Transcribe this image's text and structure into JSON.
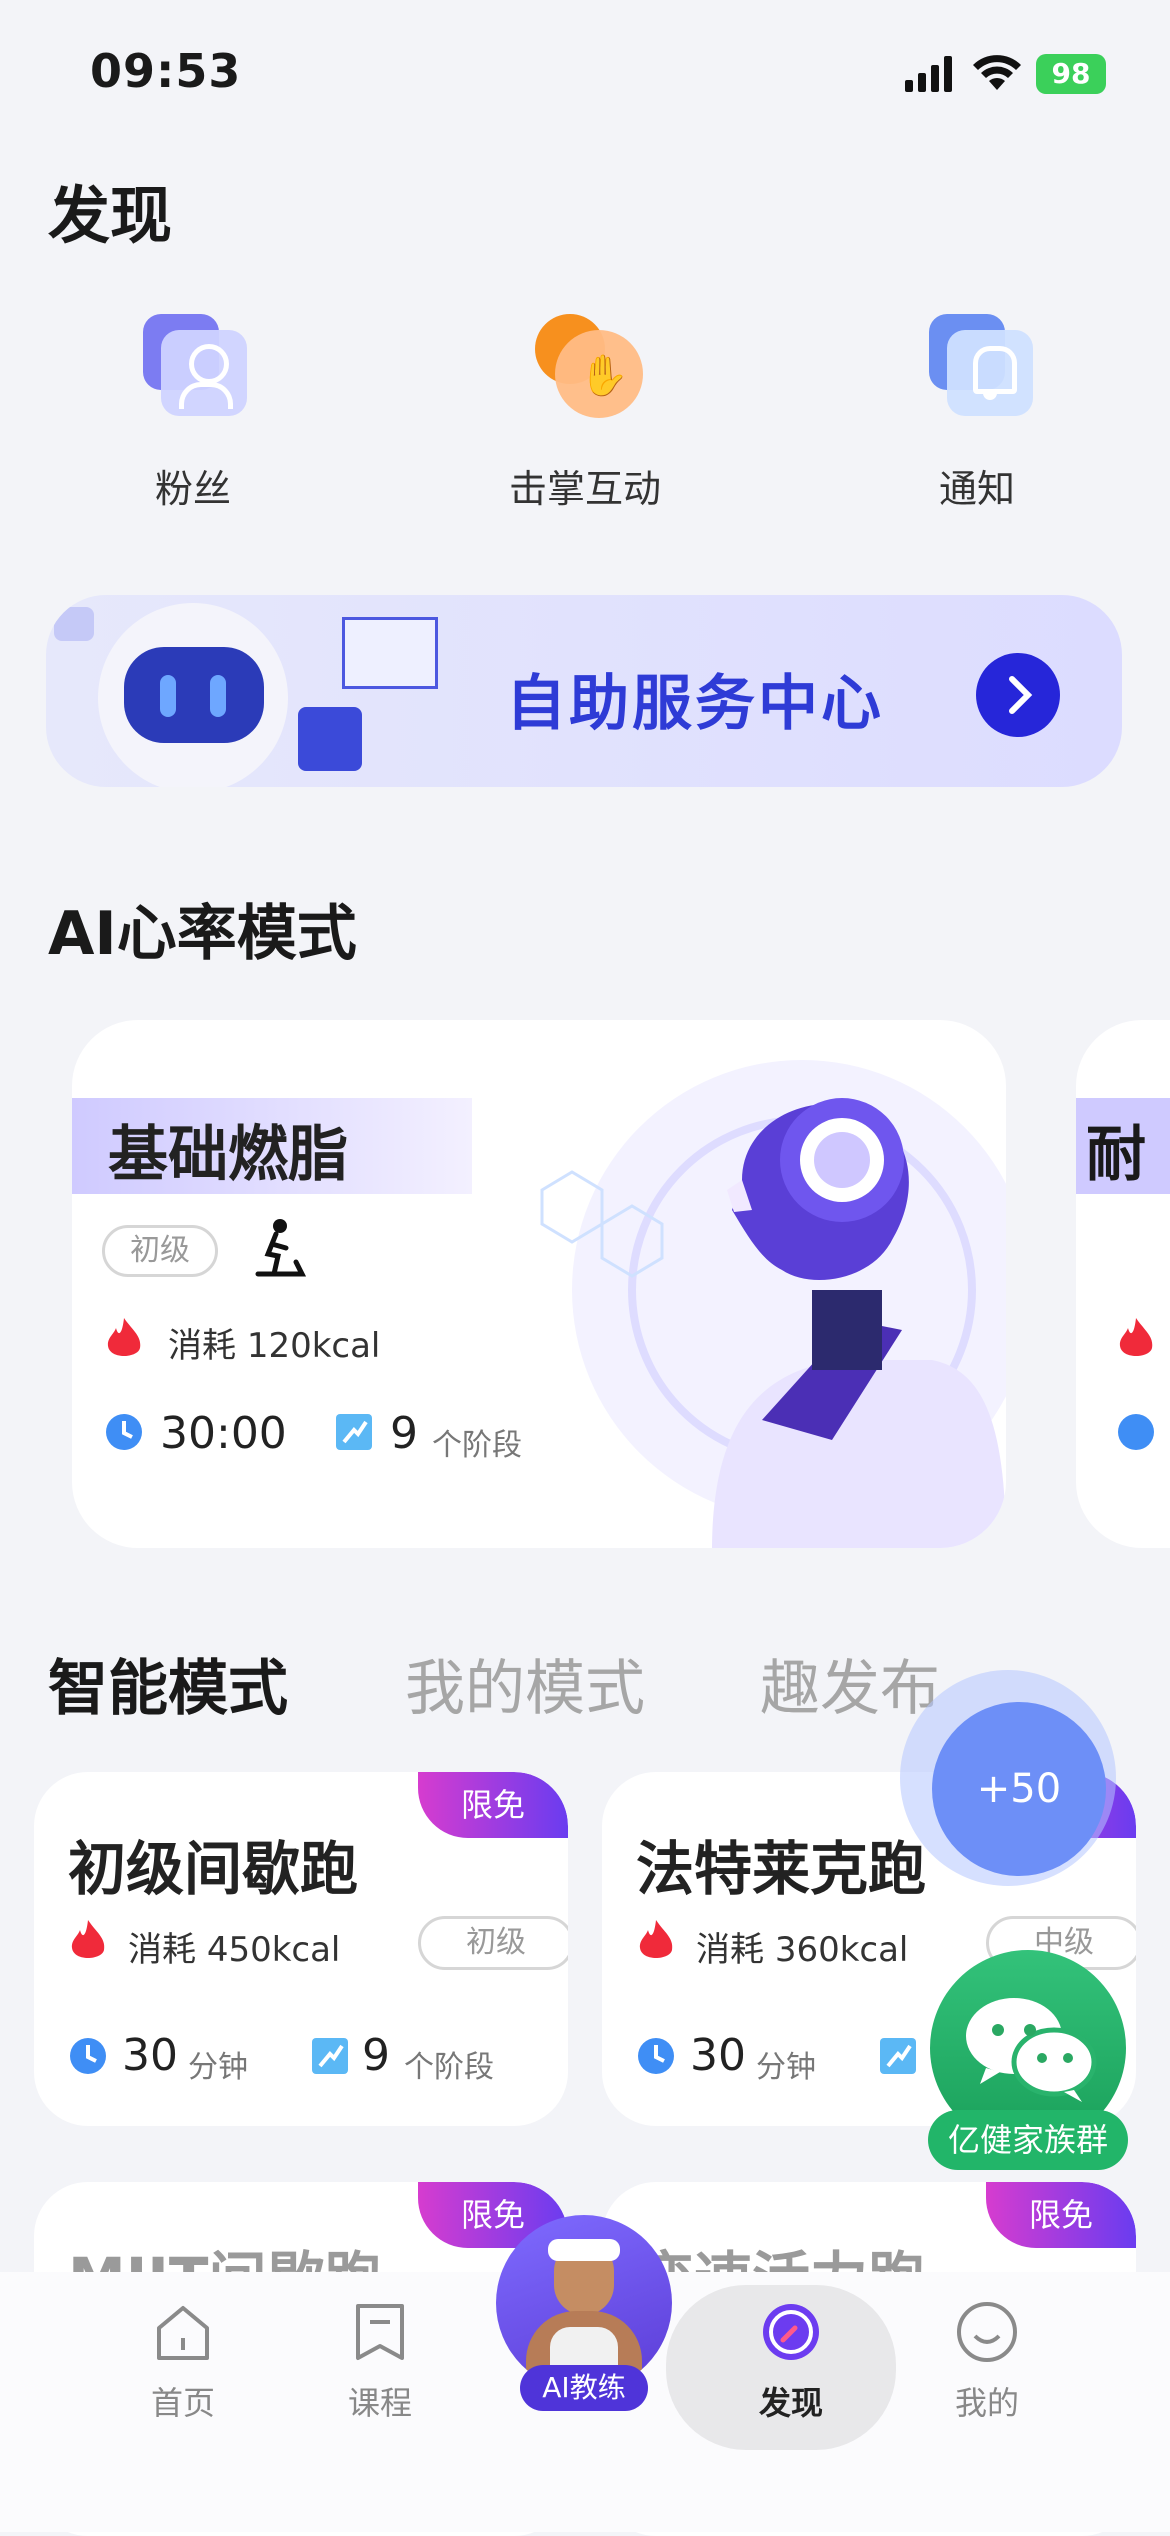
{
  "status_bar": {
    "time": "09:53",
    "battery": "98"
  },
  "page_title": "发现",
  "quick_actions": [
    {
      "label": "粉丝",
      "icon": "fans-icon"
    },
    {
      "label": "击掌互动",
      "icon": "high-five-icon"
    },
    {
      "label": "通知",
      "icon": "bell-icon"
    }
  ],
  "banner": {
    "text": "自助服务中心"
  },
  "ai_section": {
    "title": "AI心率模式",
    "card": {
      "title": "基础燃脂",
      "level": "初级",
      "burn_label": "消耗",
      "burn_value": "120kcal",
      "duration": "30:00",
      "stages": "9",
      "stages_unit": "个阶段"
    },
    "peek_title": "耐"
  },
  "tabs": [
    "智能模式",
    "我的模式",
    "趣发布"
  ],
  "mode_cards": [
    {
      "badge": "限免",
      "name": "初级间歇跑",
      "burn_label": "消耗",
      "burn_value": "450kcal",
      "level": "初级",
      "minutes": "30",
      "minutes_unit": "分钟",
      "stages": "9",
      "stages_unit": "个阶段"
    },
    {
      "badge": "限免",
      "name": "法特莱克跑",
      "burn_label": "消耗",
      "burn_value": "360kcal",
      "level": "中级",
      "minutes": "30",
      "minutes_unit": "分钟",
      "stages": "",
      "stages_unit": ""
    },
    {
      "badge": "限免",
      "name": "MIIT间歇跑"
    },
    {
      "badge": "限免",
      "name": "变速活力跑"
    }
  ],
  "floating": {
    "points": "+50",
    "wechat_group": "亿健家族群"
  },
  "tabbar": {
    "items": [
      {
        "label": "首页",
        "icon": "home-icon"
      },
      {
        "label": "课程",
        "icon": "bookmark-icon"
      },
      {
        "label": "AI教练",
        "icon": "coach-avatar"
      },
      {
        "label": "发现",
        "icon": "compass-icon"
      },
      {
        "label": "我的",
        "icon": "smile-icon"
      }
    ],
    "active": "发现"
  },
  "colors": {
    "accent": "#2626d9",
    "brand_purple": "#6a3cf0",
    "fire": "#f02a3a",
    "clock": "#3f8ef5",
    "wechat": "#22b569"
  }
}
